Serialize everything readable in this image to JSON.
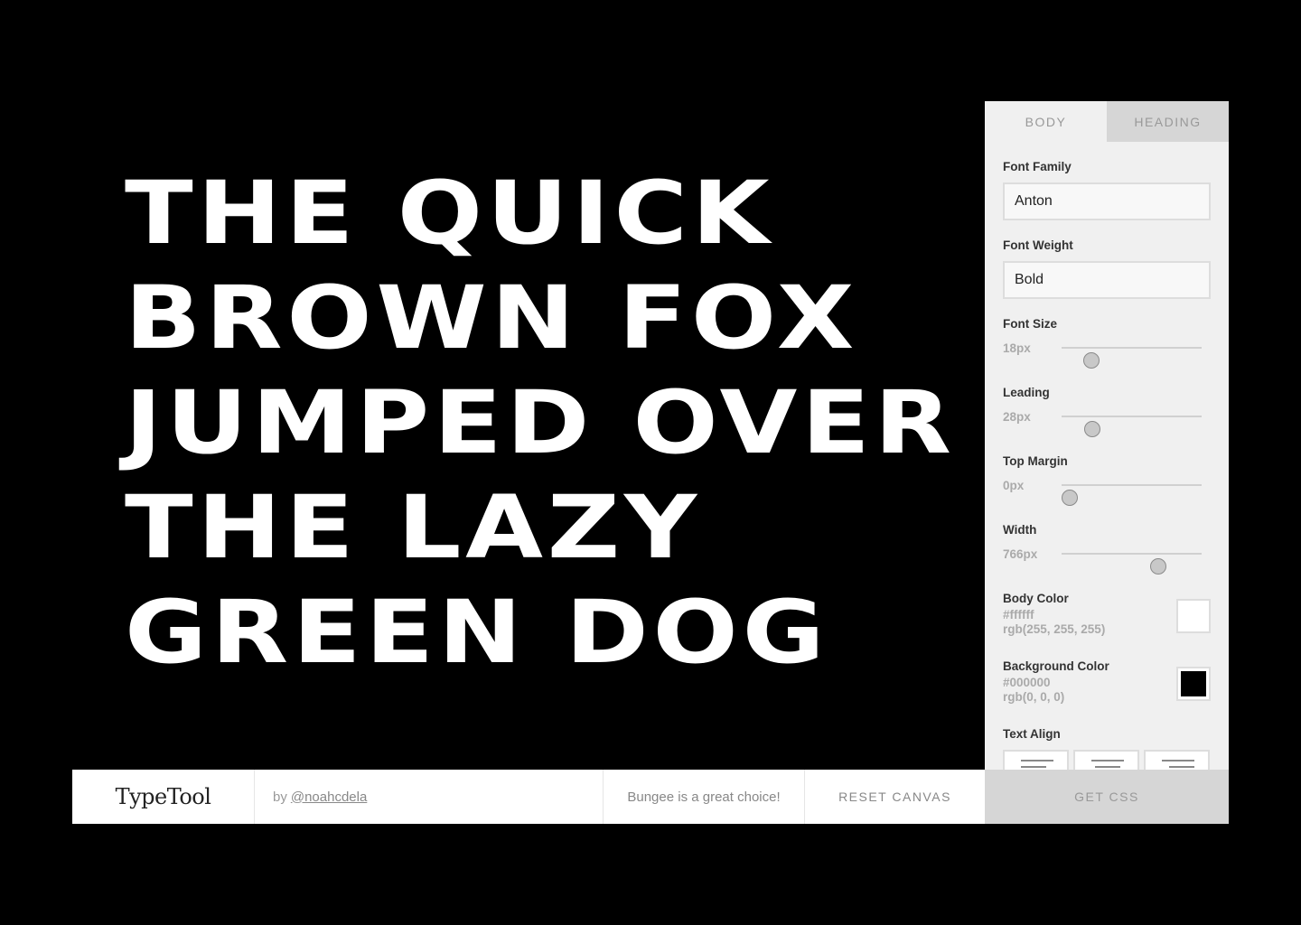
{
  "canvas": {
    "background": "#000000",
    "text_color": "#ffffff",
    "lines": [
      "The quick",
      "brown fox",
      "jumped over",
      "the lazy",
      "green dog"
    ]
  },
  "panel": {
    "tabs": [
      {
        "label": "BODY",
        "active": true
      },
      {
        "label": "HEADING",
        "active": false
      }
    ],
    "font_family": {
      "label": "Font Family",
      "value": "Anton"
    },
    "font_weight": {
      "label": "Font Weight",
      "value": "Bold"
    },
    "font_size": {
      "label": "Font Size",
      "value": "18px",
      "level": 0.21
    },
    "leading": {
      "label": "Leading",
      "value": "28px",
      "level": 0.22
    },
    "top_margin": {
      "label": "Top Margin",
      "value": "0px",
      "level": 0.06
    },
    "width": {
      "label": "Width",
      "value": "766px",
      "level": 0.69
    },
    "body_color": {
      "label": "Body Color",
      "hex": "#ffffff",
      "rgb": "rgb(255, 255, 255)"
    },
    "background_color": {
      "label": "Background Color",
      "hex": "#000000",
      "rgb": "rgb(0, 0, 0)"
    },
    "text_align": {
      "label": "Text Align",
      "options": [
        "left",
        "center",
        "right"
      ]
    }
  },
  "footer": {
    "logo": "TypeTool",
    "by_prefix": "by",
    "author": "@noahcdela",
    "tip": "Bungee is a great choice!",
    "reset": "RESET CANVAS",
    "get_css": "GET CSS"
  }
}
